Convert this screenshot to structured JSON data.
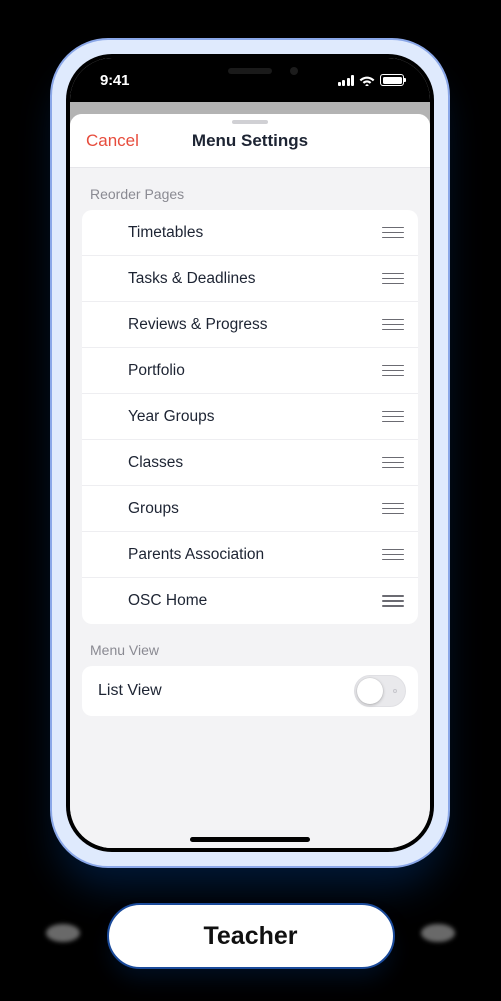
{
  "status": {
    "time": "9:41"
  },
  "sheet": {
    "cancel": "Cancel",
    "title": "Menu Settings"
  },
  "sections": {
    "reorder_label": "Reorder Pages",
    "menu_view_label": "Menu View"
  },
  "pages": [
    {
      "label": "Timetables"
    },
    {
      "label": "Tasks & Deadlines"
    },
    {
      "label": "Reviews & Progress"
    },
    {
      "label": "Portfolio"
    },
    {
      "label": "Year Groups"
    },
    {
      "label": "Classes"
    },
    {
      "label": "Groups"
    },
    {
      "label": "Parents Association"
    },
    {
      "label": "OSC Home"
    }
  ],
  "menu_view": {
    "label": "List View",
    "on": false
  },
  "role_badge": "Teacher"
}
